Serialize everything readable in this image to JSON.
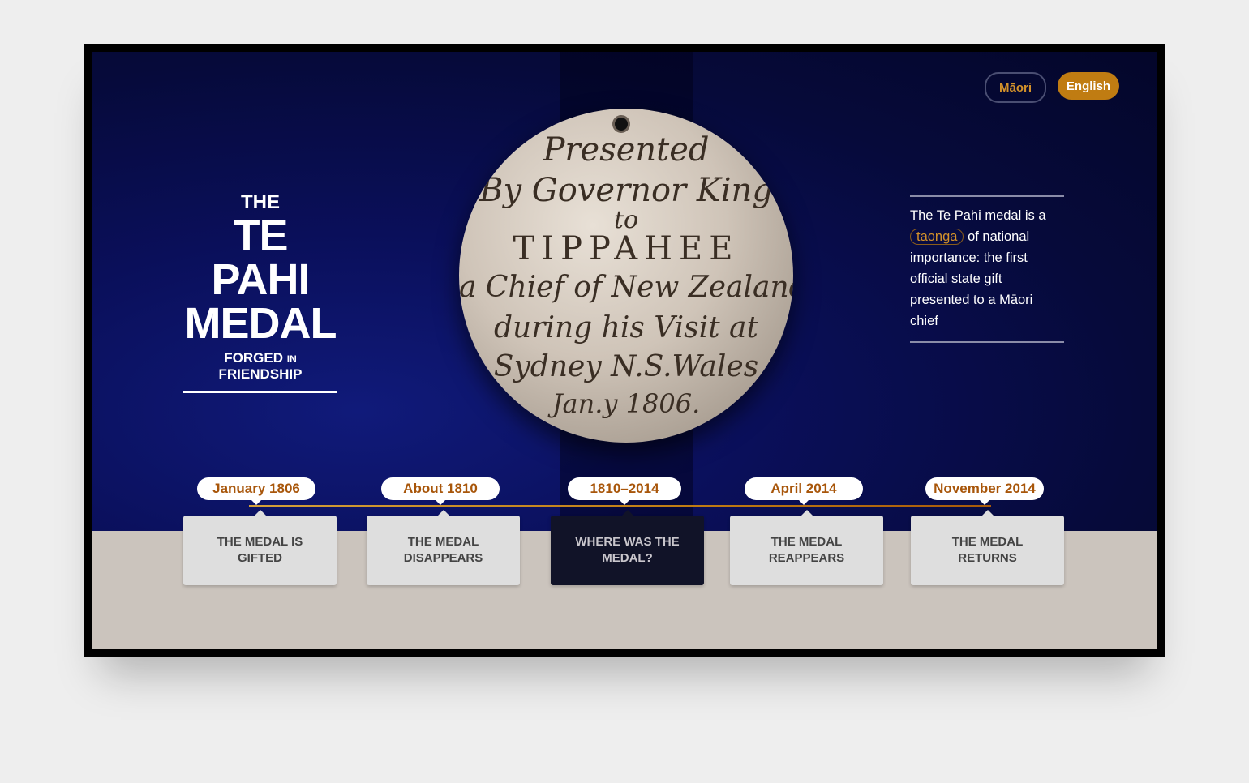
{
  "language_buttons": {
    "maori": "Māori",
    "english": "English",
    "active": "English"
  },
  "title": {
    "the": "THE",
    "line1": "TE PAHI",
    "line2": "MEDAL",
    "subtitle_a": "FORGED",
    "subtitle_in": "IN",
    "subtitle_b": "FRIENDSHIP"
  },
  "description": {
    "before": "The Te Pahi medal is a",
    "highlight": "taonga",
    "after": "of national importance: the first official state gift presented to a Māori chief"
  },
  "medal_inscription": [
    "Presented",
    "By Governor King",
    "to",
    "TIPPAHEE",
    "a Chief of New Zealand",
    "during his Visit at",
    "Sydney N.S.Wales",
    "Jan.y 1806."
  ],
  "timeline": [
    {
      "date": "January 1806",
      "label": "THE MEDAL IS GIFTED",
      "active": false
    },
    {
      "date": "About 1810",
      "label": "THE MEDAL DISAPPEARS",
      "active": false
    },
    {
      "date": "1810–2014",
      "label": "WHERE WAS THE MEDAL?",
      "active": true
    },
    {
      "date": "April 2014",
      "label": "THE MEDAL REAPPEARS",
      "active": false
    },
    {
      "date": "November 2014",
      "label": "THE MEDAL RETURNS",
      "active": false
    }
  ],
  "colors": {
    "accent": "#c07c12",
    "date_text": "#a8560a",
    "hero_bg": "#0a0f5a",
    "lower_bg": "#cbc4bd"
  }
}
